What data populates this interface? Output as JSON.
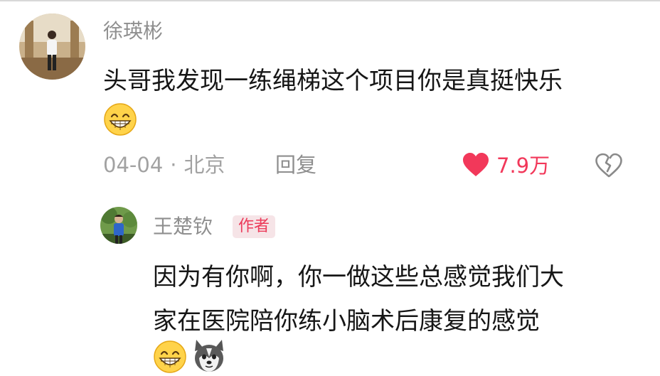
{
  "comment": {
    "username": "徐瑛彬",
    "text": "头哥我发现一练绳梯这个项目你是真挺快乐",
    "emoji": "grinning-emoji",
    "date": "04-04",
    "separator": "·",
    "location": "北京",
    "reply_label": "回复",
    "like_count": "7.9万",
    "like_color": "#f2385a"
  },
  "reply": {
    "username": "王楚钦",
    "badge": "作者",
    "text_lines": [
      "因为有你啊，你一做这些总感觉我们大",
      "家在医院陪你练小脑术后康复的感觉"
    ],
    "emojis": [
      "grinning-emoji",
      "husky-emoji"
    ]
  }
}
